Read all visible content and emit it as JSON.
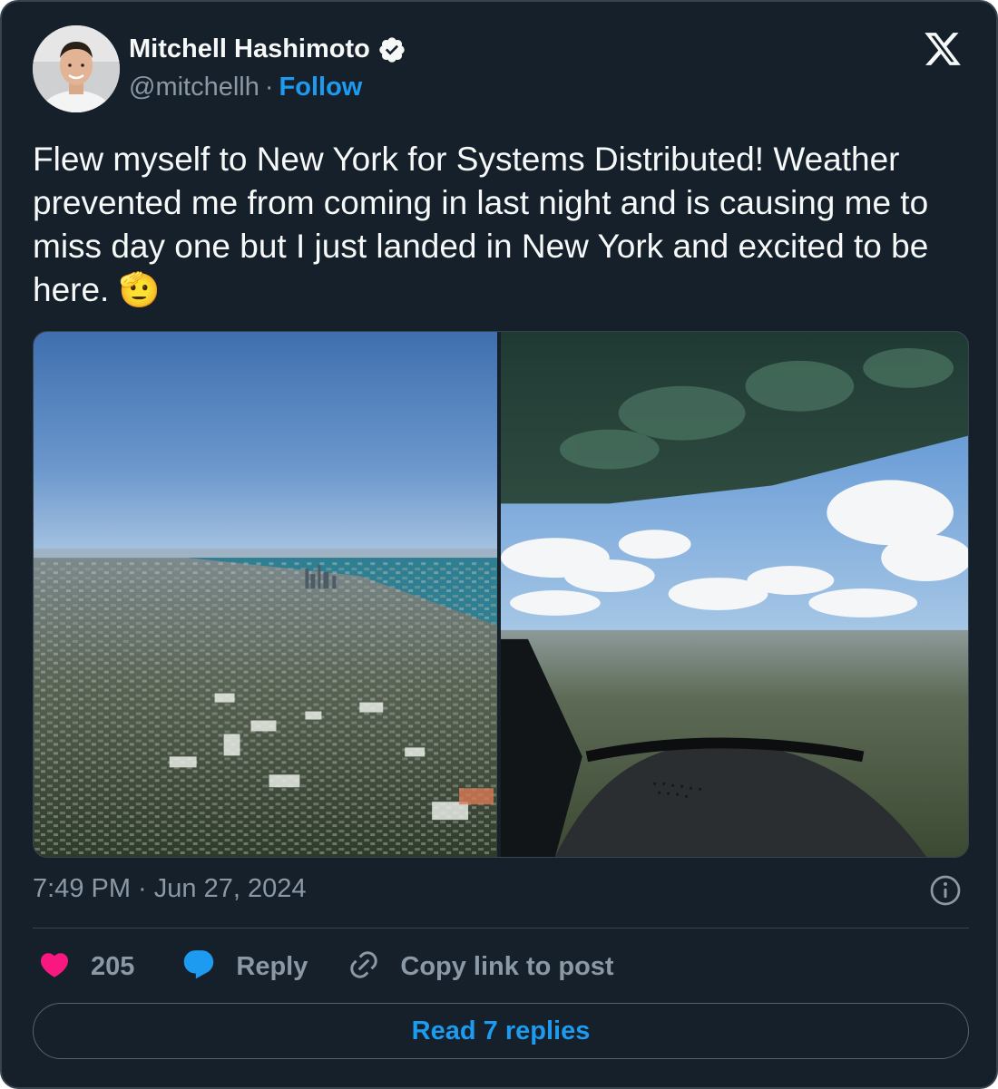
{
  "author": {
    "name": "Mitchell Hashimoto",
    "handle": "@mitchellh",
    "separator": "·",
    "follow_label": "Follow",
    "verified": true
  },
  "tweet": {
    "text": "Flew myself to New York for Systems Distributed! Weather prevented me from coming in last night and is causing me to miss day one but I just landed in New York and excited to be here. 🫡",
    "media": [
      {
        "description": "aerial view of city and lake from airplane"
      },
      {
        "description": "cockpit view over city with clouds"
      }
    ],
    "timestamp": "7:49 PM · Jun 27, 2024"
  },
  "actions": {
    "like_count": "205",
    "reply_label": "Reply",
    "copy_label": "Copy link to post"
  },
  "read_replies_label": "Read 7 replies",
  "icons": {
    "logo": "x-logo-icon",
    "verified": "verified-badge-icon",
    "like": "heart-icon",
    "reply": "speech-bubble-icon",
    "copy": "link-icon",
    "info": "info-icon"
  },
  "colors": {
    "background": "#15202b",
    "border": "#38444d",
    "accent": "#1d9bf0",
    "like": "#f91880",
    "muted": "#8b98a5",
    "text": "#f7f9f9"
  }
}
